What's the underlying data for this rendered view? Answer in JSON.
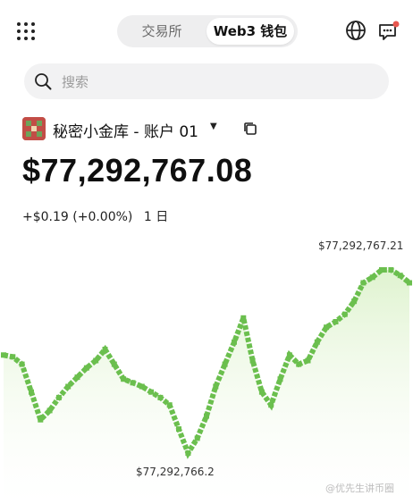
{
  "header": {
    "tabs": [
      {
        "label": "交易所",
        "active": false
      },
      {
        "label": "Web3 钱包",
        "active": true
      }
    ],
    "icons": [
      "grid-icon",
      "globe-icon",
      "chat-bubble-icon"
    ],
    "notification_dot_color": "#e8574f"
  },
  "search": {
    "placeholder": "搜索",
    "value": ""
  },
  "account": {
    "name": "秘密小金库 - 账户 01",
    "avatar_color": "#c24d46"
  },
  "balance": {
    "amount": "$77,292,767.08"
  },
  "change": {
    "value": "+$0.19 (+0.00%)",
    "period": "1 日",
    "color": "#4a9b2f"
  },
  "chart_data": {
    "type": "line",
    "high_label": "$77,292,767.21",
    "low_label": "$77,292,766.2",
    "values": [
      77292766.75,
      77292766.74,
      77292766.7,
      77292766.55,
      77292766.4,
      77292766.45,
      77292766.52,
      77292766.58,
      77292766.63,
      77292766.68,
      77292766.72,
      77292766.78,
      77292766.7,
      77292766.62,
      77292766.6,
      77292766.58,
      77292766.55,
      77292766.52,
      77292766.48,
      77292766.35,
      77292766.22,
      77292766.3,
      77292766.42,
      77292766.58,
      77292766.7,
      77292766.82,
      77292766.95,
      77292766.72,
      77292766.55,
      77292766.48,
      77292766.62,
      77292766.75,
      77292766.7,
      77292766.72,
      77292766.82,
      77292766.9,
      77292766.93,
      77292766.97,
      77292767.04,
      77292767.14,
      77292767.17,
      77292767.21,
      77292767.21,
      77292767.18,
      77292767.14
    ],
    "line_color": "#6bbf4e",
    "fill_color": "#e6f6d9"
  },
  "watermark": "@优先生讲币圈"
}
